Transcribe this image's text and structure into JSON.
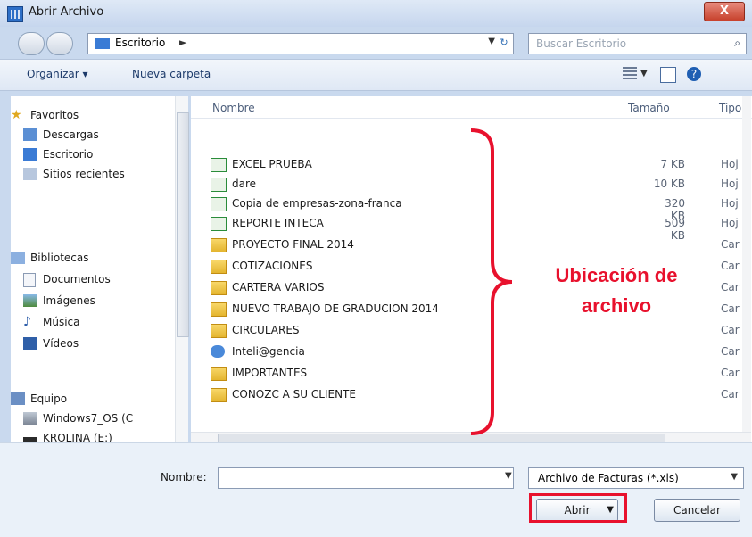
{
  "window": {
    "title": "Abrir Archivo",
    "close_label": "X"
  },
  "nav": {
    "address": "Escritorio",
    "address_arrow": "►",
    "search_placeholder": "Buscar Escritorio"
  },
  "toolbar": {
    "organize": "Organizar ▾",
    "new_folder": "Nueva carpeta"
  },
  "sidebar": {
    "items": [
      {
        "label": "Favoritos",
        "icon": "star-icon"
      },
      {
        "label": "Descargas",
        "icon": "download-folder-icon"
      },
      {
        "label": "Escritorio",
        "icon": "desktop-icon"
      },
      {
        "label": "Sitios recientes",
        "icon": "recent-places-icon"
      },
      {
        "label": "Bibliotecas",
        "icon": "libraries-icon"
      },
      {
        "label": "Documentos",
        "icon": "documents-icon"
      },
      {
        "label": "Imágenes",
        "icon": "pictures-icon"
      },
      {
        "label": "Música",
        "icon": "music-icon"
      },
      {
        "label": "Vídeos",
        "icon": "videos-icon"
      },
      {
        "label": "Equipo",
        "icon": "computer-icon"
      },
      {
        "label": "Windows7_OS (C",
        "icon": "drive-icon"
      },
      {
        "label": "KROLINA (E:)",
        "icon": "usb-drive-icon"
      }
    ]
  },
  "files": {
    "headers": {
      "name": "Nombre",
      "size": "Tamaño",
      "type": "Tipo"
    },
    "rows": [
      {
        "name": "EXCEL PRUEBA",
        "size": "7 KB",
        "type": "Hoj",
        "icon": "excel-file-icon"
      },
      {
        "name": "dare",
        "size": "10 KB",
        "type": "Hoj",
        "icon": "excel-file-icon"
      },
      {
        "name": "Copia de empresas-zona-franca",
        "size": "320 KB",
        "type": "Hoj",
        "icon": "excel-file-icon"
      },
      {
        "name": "REPORTE INTECA",
        "size": "509 KB",
        "type": "Hoj",
        "icon": "excel-file-icon"
      },
      {
        "name": "PROYECTO FINAL 2014",
        "size": "",
        "type": "Car",
        "icon": "folder-icon"
      },
      {
        "name": "COTIZACIONES",
        "size": "",
        "type": "Car",
        "icon": "folder-icon"
      },
      {
        "name": "CARTERA VARIOS",
        "size": "",
        "type": "Car",
        "icon": "folder-icon"
      },
      {
        "name": "NUEVO TRABAJO DE GRADUCION 2014",
        "size": "",
        "type": "Car",
        "icon": "folder-icon"
      },
      {
        "name": "CIRCULARES",
        "size": "",
        "type": "Car",
        "icon": "folder-icon"
      },
      {
        "name": "Inteli@gencia",
        "size": "",
        "type": "Car",
        "icon": "shortcut-icon"
      },
      {
        "name": "IMPORTANTES",
        "size": "",
        "type": "Car",
        "icon": "folder-icon"
      },
      {
        "name": "CONOZC A SU CLIENTE",
        "size": "",
        "type": "Car",
        "icon": "folder-icon"
      }
    ]
  },
  "annotation": {
    "line1": "Ubicación de",
    "line2": "archivo",
    "color": "#e8112d"
  },
  "footer": {
    "name_label": "Nombre:",
    "name_value": "",
    "filter": "Archivo de Facturas (*.xls)",
    "open": "Abrir",
    "cancel": "Cancelar"
  }
}
